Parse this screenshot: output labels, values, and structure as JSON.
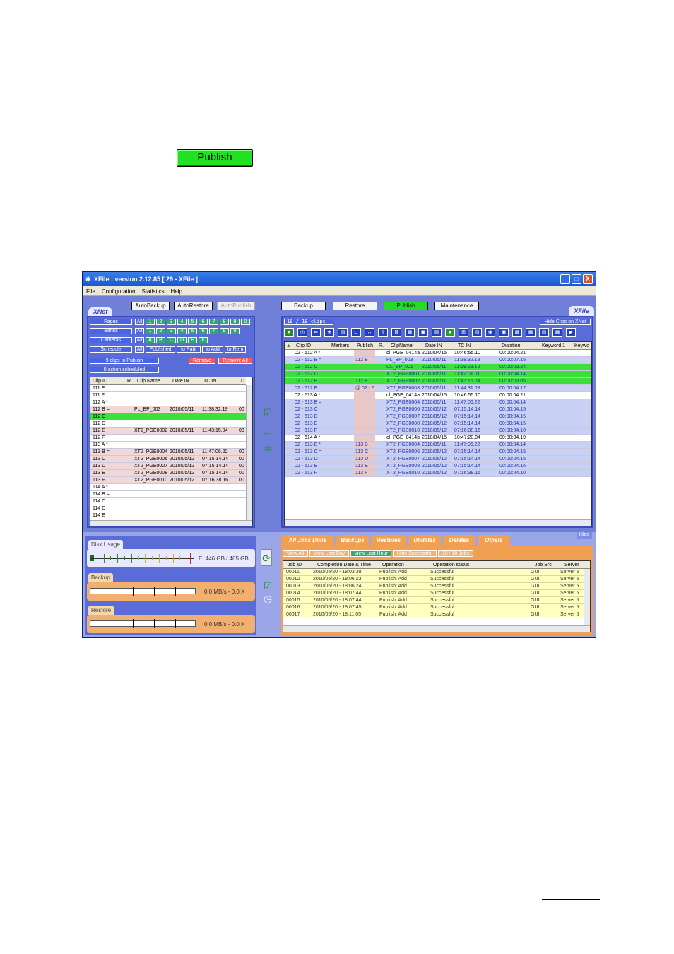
{
  "publish_button_label": "Publish",
  "window": {
    "title": "XFile : version 2.12.85 [ 29 - XFile ]",
    "menu": [
      "File",
      "Configuration",
      "Statistics",
      "Help"
    ],
    "controls": [
      "_",
      "□",
      "X"
    ]
  },
  "xnet": {
    "tab_label": "XNet",
    "top_buttons": [
      "AutoBackup",
      "AutoRestore",
      "AutoPublish"
    ],
    "filters": [
      {
        "label": "Pages",
        "boxes": [
          "All",
          "1",
          "2",
          "3",
          "4",
          "5",
          "6",
          "7",
          "8",
          "9",
          "0"
        ]
      },
      {
        "label": "Banks",
        "boxes": [
          "All",
          "1",
          "2",
          "3",
          "4",
          "5",
          "6",
          "7",
          "8",
          "9"
        ]
      },
      {
        "label": "Cameras",
        "boxes": [
          "All",
          "A",
          "B",
          "C",
          "D",
          "E",
          "F"
        ]
      },
      {
        "label": "Schedule",
        "boxes": [
          "All",
          "Published",
          "to Publ",
          "to Add",
          "to Rem"
        ]
      }
    ],
    "clips_to_publish": "9 clips to Publish",
    "actions_scheduled": "0 action  scheduled",
    "remove_label": "Remove",
    "remove_all_label": "Remove All",
    "columns": [
      "Clip ID",
      "R.",
      "Clip Name",
      "Date IN",
      "TC IN",
      "D"
    ],
    "rows": [
      {
        "id": "111 E",
        "name": "",
        "date": "",
        "tc": "",
        "d": "",
        "style": "white"
      },
      {
        "id": "111 F",
        "name": "",
        "date": "",
        "tc": "",
        "d": "",
        "style": "white"
      },
      {
        "id": "112 A *",
        "name": "",
        "date": "",
        "tc": "",
        "d": "",
        "style": "white"
      },
      {
        "id": "112 B =",
        "name": "PL_BP_003",
        "date": "2010/05/11",
        "tc": "11:38:32.19",
        "d": "00",
        "style": "pink"
      },
      {
        "id": "112 C",
        "name": "",
        "date": "",
        "tc": "",
        "d": "",
        "style": "green"
      },
      {
        "id": "112 D",
        "name": "",
        "date": "",
        "tc": "",
        "d": "",
        "style": "white"
      },
      {
        "id": "112 E",
        "name": "XT2_PGE0002",
        "date": "2010/05/11",
        "tc": "11:43:15.04",
        "d": "00",
        "style": "pink"
      },
      {
        "id": "112 F",
        "name": "",
        "date": "",
        "tc": "",
        "d": "",
        "style": "white"
      },
      {
        "id": "113 A *",
        "name": "",
        "date": "",
        "tc": "",
        "d": "",
        "style": "white"
      },
      {
        "id": "113 B =",
        "name": "XT2_PGE0004",
        "date": "2010/05/11",
        "tc": "11:47:06.22",
        "d": "00",
        "style": "pink"
      },
      {
        "id": "113 C",
        "name": "XT2_PGE0006",
        "date": "2010/05/12",
        "tc": "07:15:14.14",
        "d": "00",
        "style": "pink"
      },
      {
        "id": "113 D",
        "name": "XT2_PGE0007",
        "date": "2010/05/12",
        "tc": "07:15:14.14",
        "d": "00",
        "style": "pink"
      },
      {
        "id": "113 E",
        "name": "XT2_PGE0008",
        "date": "2010/05/12",
        "tc": "07:15:14.14",
        "d": "00",
        "style": "pink"
      },
      {
        "id": "113 F",
        "name": "XT2_PGE0010",
        "date": "2010/05/12",
        "tc": "07:16:38.16",
        "d": "00",
        "style": "pink"
      },
      {
        "id": "114 A *",
        "name": "",
        "date": "",
        "tc": "",
        "d": "",
        "style": "white"
      },
      {
        "id": "114 B =",
        "name": "",
        "date": "",
        "tc": "",
        "d": "",
        "style": "white"
      },
      {
        "id": "114 C",
        "name": "",
        "date": "",
        "tc": "",
        "d": "",
        "style": "white"
      },
      {
        "id": "114 D",
        "name": "",
        "date": "",
        "tc": "",
        "d": "",
        "style": "white"
      },
      {
        "id": "114 E",
        "name": "",
        "date": "",
        "tc": "",
        "d": "",
        "style": "white"
      }
    ]
  },
  "xfile": {
    "tab_label": "XFile",
    "top_buttons": [
      "Backup",
      "Restore",
      "Publish",
      "Maintenance"
    ],
    "clip_count": "18 / 18 clips",
    "hide_clips_label": "Hide Clips on XNet",
    "columns": [
      "Clip ID",
      "Markers",
      "Publish",
      "R.",
      "ClipName",
      "Date IN",
      "TC IN",
      "Duration",
      "Keyword 1",
      "Keywo"
    ],
    "rows": [
      {
        "id": "02 - 612 A *",
        "pub": "",
        "name": "cl_PGE_0414a",
        "date": "2010/04/15",
        "tc": "10:46:55.10",
        "dur": "00:00:04.21",
        "style": "white"
      },
      {
        "id": "02 - 612 B =",
        "pub": "112 B",
        "name": "PL_BP_003",
        "date": "2010/05/11",
        "tc": "11:38:32.19",
        "dur": "00:00:07.15",
        "style": "blue"
      },
      {
        "id": "02 - 612 C",
        "pub": "",
        "name": "CL_BP_001",
        "date": "2010/05/11",
        "tc": "11:39:23.12",
        "dur": "00:00:03.24",
        "style": "green"
      },
      {
        "id": "02 - 612 D",
        "pub": "",
        "name": "XT2_PGE0001",
        "date": "2010/05/11",
        "tc": "11:42:01.01",
        "dur": "00:00:04.14",
        "style": "green"
      },
      {
        "id": "02 - 612 E",
        "pub": "112 E",
        "name": "XT2_PGE0002",
        "date": "2010/05/11",
        "tc": "11:43:15.04",
        "dur": "00:00:03.05",
        "style": "green"
      },
      {
        "id": "02 - 612 F",
        "pub": "@ 02 - 6",
        "name": "XT2_PGE0003",
        "date": "2010/05/11",
        "tc": "11:44:31.08",
        "dur": "00:00:04.17",
        "style": "blue"
      },
      {
        "id": "02 - 613 A *",
        "pub": "",
        "name": "cl_PGE_0414a",
        "date": "2010/04/15",
        "tc": "10:46:55.10",
        "dur": "00:00:04.21",
        "style": "white"
      },
      {
        "id": "02 - 613 B =",
        "pub": "",
        "name": "XT2_PGE0004",
        "date": "2010/05/11",
        "tc": "11:47:06.22",
        "dur": "00:00:04.14",
        "style": "blue"
      },
      {
        "id": "02 - 613 C",
        "pub": "",
        "name": "XT2_PGE0006",
        "date": "2010/05/12",
        "tc": "07:15:14.14",
        "dur": "00:00:04.15",
        "style": "blue"
      },
      {
        "id": "02 - 613 D",
        "pub": "",
        "name": "XT2_PGE0007",
        "date": "2010/05/12",
        "tc": "07:15:14.14",
        "dur": "00:00:04.15",
        "style": "blue"
      },
      {
        "id": "02 - 613 E",
        "pub": "",
        "name": "XT2_PGE0008",
        "date": "2010/05/12",
        "tc": "07:15:14.14",
        "dur": "00:00:04.15",
        "style": "blue"
      },
      {
        "id": "02 - 613 F",
        "pub": "",
        "name": "XT2_PGE0010",
        "date": "2010/05/12",
        "tc": "07:16:38.16",
        "dur": "00:00:04.10",
        "style": "blue"
      },
      {
        "id": "02 - 614 A *",
        "pub": "",
        "name": "cl_PGE_0414b",
        "date": "2010/04/15",
        "tc": "10:47:20.04",
        "dur": "00:00:04.19",
        "style": "white"
      },
      {
        "id": "02 - 613 B *",
        "pub": "113 B",
        "name": "XT2_PGE0004",
        "date": "2010/05/11",
        "tc": "11:47:06.22",
        "dur": "00:00:04.14",
        "style": "blue"
      },
      {
        "id": "02 - 613 C =",
        "pub": "113 C",
        "name": "XT2_PGE0006",
        "date": "2010/05/12",
        "tc": "07:15:14.14",
        "dur": "00:00:04.15",
        "style": "blue"
      },
      {
        "id": "02 - 613 D",
        "pub": "113 D",
        "name": "XT2_PGE0007",
        "date": "2010/05/12",
        "tc": "07:15:14.14",
        "dur": "00:00:04.15",
        "style": "blue"
      },
      {
        "id": "02 - 613 E",
        "pub": "113 E",
        "name": "XT2_PGE0008",
        "date": "2010/05/12",
        "tc": "07:15:14.14",
        "dur": "00:00:04.15",
        "style": "blue"
      },
      {
        "id": "02 - 613 F",
        "pub": "113 F",
        "name": "XT2_PGE0010",
        "date": "2010/05/12",
        "tc": "07:16:38.16",
        "dur": "00:00:04.10",
        "style": "blue"
      }
    ]
  },
  "status": {
    "disk_usage_label": "Disk Usage",
    "disk_usage_value": "E: 446 GB / 465 GB",
    "disk_usage_fraction": 0.96,
    "backup_label": "Backup",
    "backup_value": "0.0 MB/s - 0.0 X",
    "restore_label": "Restore",
    "restore_value": "0.0 MB/s - 0.0 X"
  },
  "jobs": {
    "hide_label": "Hide",
    "tabs": [
      "All Jobs Done",
      "Backups",
      "Restores",
      "Updates",
      "Deletes",
      "Others"
    ],
    "filters": [
      "View All",
      "View Last Day",
      "View Last Hour",
      "Hide Successful",
      "18 / 18 Jobs"
    ],
    "columns": [
      "Job ID",
      "Completion Date & Time",
      "Operation",
      "Operation status",
      "Job Src",
      "Server"
    ],
    "rows": [
      {
        "id": "00011",
        "time": "2010/05/20 - 18:03:38",
        "op": "Publish: Add",
        "status": "Successful",
        "src": "GUI",
        "server": "Server 5"
      },
      {
        "id": "00012",
        "time": "2010/05/20 - 18:06:23",
        "op": "Publish: Add",
        "status": "Successful",
        "src": "GUI",
        "server": "Server 5"
      },
      {
        "id": "00013",
        "time": "2010/05/20 - 18:06:24",
        "op": "Publish: Add",
        "status": "Successful",
        "src": "GUI",
        "server": "Server 5"
      },
      {
        "id": "00014",
        "time": "2010/05/20 - 18:07:44",
        "op": "Publish: Add",
        "status": "Successful",
        "src": "GUI",
        "server": "Server 5"
      },
      {
        "id": "00015",
        "time": "2010/05/20 - 18:07:44",
        "op": "Publish: Add",
        "status": "Successful",
        "src": "GUI",
        "server": "Server 5"
      },
      {
        "id": "00016",
        "time": "2010/05/20 - 18:07:45",
        "op": "Publish: Add",
        "status": "Successful",
        "src": "GUI",
        "server": "Server 5"
      },
      {
        "id": "00017",
        "time": "2010/05/20 - 18:11:05",
        "op": "Publish: Add",
        "status": "Successful",
        "src": "GUI",
        "server": "Server 5"
      }
    ]
  },
  "colors": {
    "panel_blue": "#5a6cd8",
    "row_green": "#3be03b",
    "row_pink": "#f0d8d8",
    "row_blue": "#c8d0f4",
    "job_yellow": "#ffffc0",
    "accent_orange": "#f0a050"
  }
}
